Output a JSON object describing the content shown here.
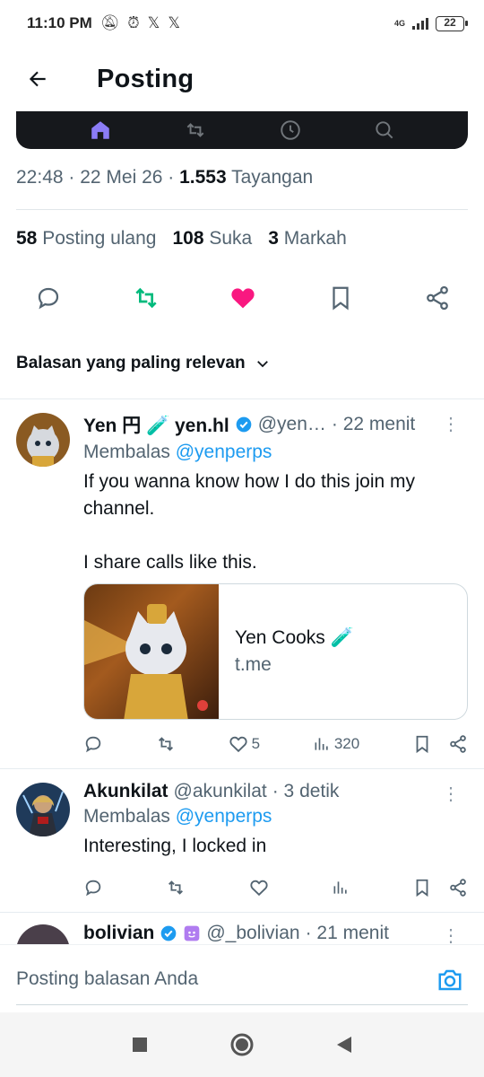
{
  "status_bar": {
    "time": "11:10 PM",
    "network": "4G",
    "battery": "22"
  },
  "header": {
    "title": "Posting"
  },
  "post": {
    "time": "22:48 · 22 Mei 26 · ",
    "views_count": "1.553",
    "views_label": " Tayangan",
    "reposts_count": "58",
    "reposts_label": "Posting ulang",
    "likes_count": "108",
    "likes_label": "Suka",
    "bookmarks_count": "3",
    "bookmarks_label": "Markah"
  },
  "sort_label": "Balasan yang paling relevan",
  "replies": [
    {
      "name": "Yen 円 🧪 yen.hl",
      "handle": "@yen…",
      "time": "· 22 menit",
      "replying_label": "Membalas",
      "replying_to": "@yenperps",
      "text": "If you wanna know how I do this join my channel.\n\nI share calls like this.",
      "card": {
        "title": "Yen Cooks 🧪",
        "domain": "t.me"
      },
      "likes": "5",
      "views": "320"
    },
    {
      "name": "Akunkilat",
      "handle": "@akunkilat",
      "time": "· 3 detik",
      "replying_label": "Membalas",
      "replying_to": "@yenperps",
      "text": "Interesting, I locked in"
    },
    {
      "name": "bolivian",
      "handle": "@_bolivian",
      "time": "· 21 menit"
    }
  ],
  "composer": {
    "placeholder": "Posting balasan Anda"
  },
  "colors": {
    "accent": "#1d9bf0",
    "repost": "#00ba7c",
    "like": "#f91880",
    "text": "#0f1419",
    "muted": "#536471"
  }
}
